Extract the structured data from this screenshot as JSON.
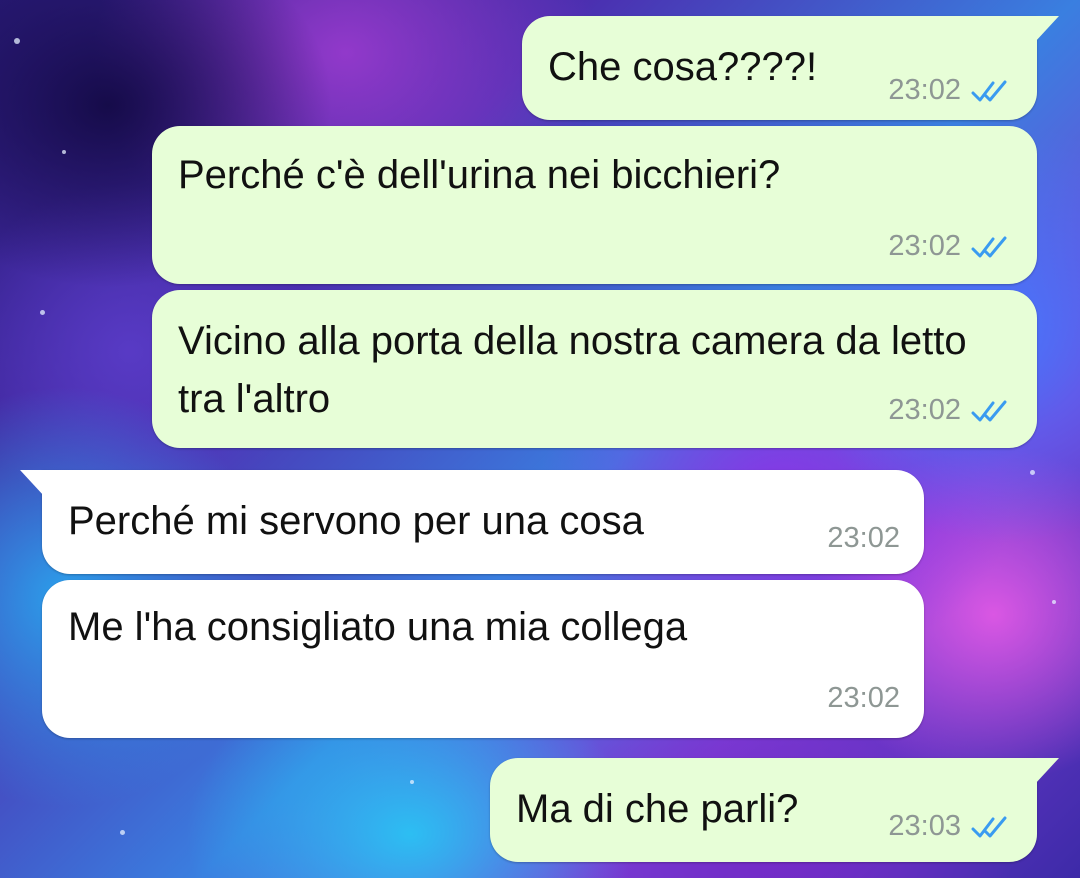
{
  "chat": {
    "messages": [
      {
        "direction": "outgoing",
        "text": "Che cosa????!",
        "time": "23:02",
        "status": "read",
        "status_icon": "double-check-icon"
      },
      {
        "direction": "outgoing",
        "text": "Perché c'è dell'urina nei bicchieri?",
        "time": "23:02",
        "status": "read",
        "status_icon": "double-check-icon"
      },
      {
        "direction": "outgoing",
        "text": "Vicino alla porta della nostra camera da letto tra l'altro",
        "time": "23:02",
        "status": "read",
        "status_icon": "double-check-icon"
      },
      {
        "direction": "incoming",
        "text": "Perché mi servono per una cosa",
        "time": "23:02"
      },
      {
        "direction": "incoming",
        "text": "Me l'ha consigliato una mia collega",
        "time": "23:02"
      },
      {
        "direction": "outgoing",
        "text": "Ma di che parli?",
        "time": "23:03",
        "status": "read",
        "status_icon": "double-check-icon"
      }
    ]
  },
  "colors": {
    "outgoing_bubble": "#e7fed7",
    "incoming_bubble": "#ffffff",
    "timestamp": "#8e9794",
    "read_ticks": "#3a9bf0"
  }
}
